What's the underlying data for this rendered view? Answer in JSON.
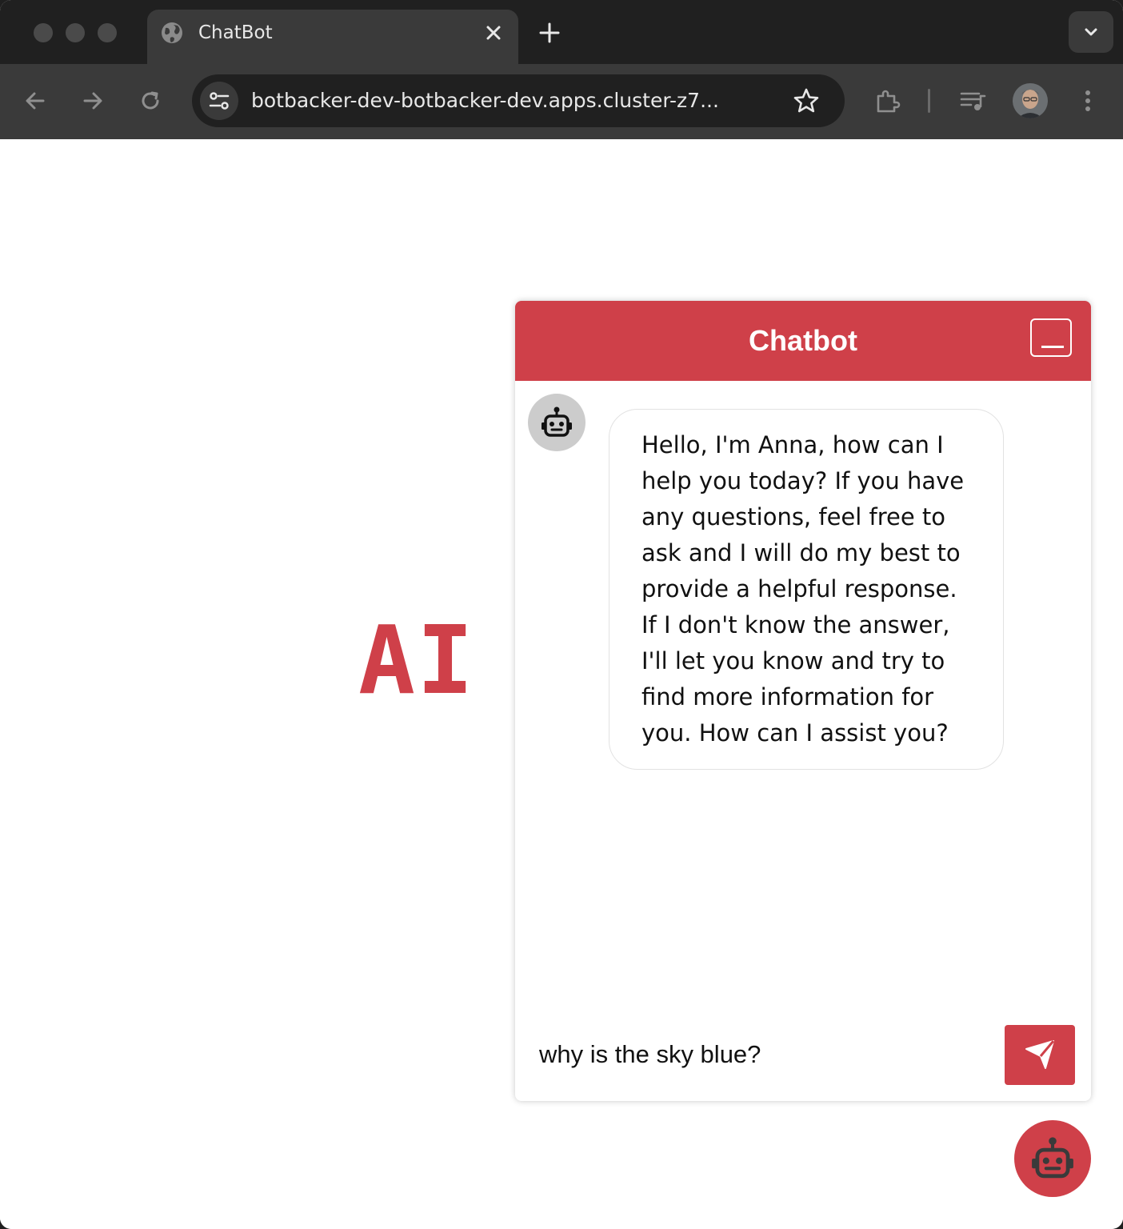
{
  "browser": {
    "tab": {
      "title": "ChatBot"
    },
    "url": "botbacker-dev-botbacker-dev.apps.cluster-z7..."
  },
  "page": {
    "logo_text": "AI"
  },
  "chat": {
    "header_title": "Chatbot",
    "messages": [
      {
        "sender": "bot",
        "text": "Hello, I'm Anna, how can I help you today? If you have any questions, feel free to ask and I will do my best to provide a helpful response. If I don't know the answer, I'll let you know and try to find more information for you. How can I assist you?"
      }
    ],
    "input_value": "why is the sky blue?"
  },
  "colors": {
    "accent": "#cf4049",
    "avatar_bg": "#cccccc"
  },
  "icons": {
    "tab": "globe-icon",
    "tab_close": "close-icon",
    "new_tab": "plus-icon",
    "tab_search": "chevron-down-icon",
    "back": "arrow-left-icon",
    "forward": "arrow-right-icon",
    "reload": "reload-icon",
    "site_info": "tune-icon",
    "bookmark": "star-icon",
    "extensions": "puzzle-icon",
    "media": "playlist-icon",
    "menu": "kebab-menu-icon",
    "minimize": "minimize-icon",
    "bot": "robot-icon",
    "send": "send-icon"
  }
}
